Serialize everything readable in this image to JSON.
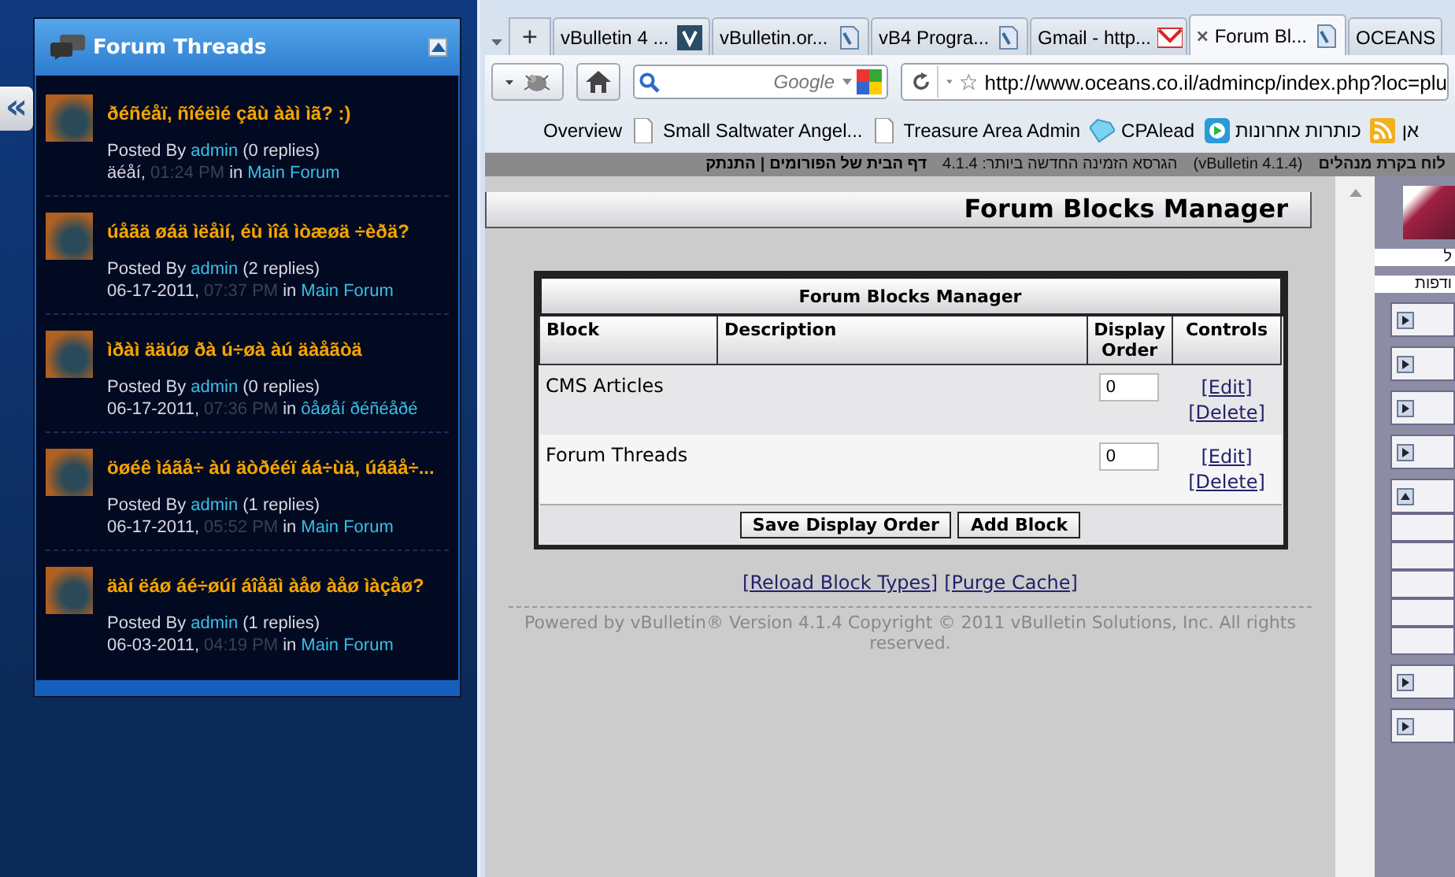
{
  "side_panel": {
    "collapse_tab": "«",
    "title": "Forum Threads",
    "threads": [
      {
        "title": "ðéñéåï, ñîéëìé çãù ààì ìã? :)",
        "posted_by": "Posted By",
        "user": "admin",
        "replies": "(0 replies)",
        "date": "äéåí,",
        "time": "01:24 PM",
        "in": "in",
        "forum": "Main Forum"
      },
      {
        "title": "úåãä øáä ìëåìí, éù ìîá ìòæøä ÷èðä?",
        "posted_by": "Posted By",
        "user": "admin",
        "replies": "(2 replies)",
        "date": "06-17-2011,",
        "time": "07:37 PM",
        "in": "in",
        "forum": "Main Forum"
      },
      {
        "title": "ìðàì ääúø ðà ú÷øà àú äàåãòä",
        "posted_by": "Posted By",
        "user": "admin",
        "replies": "(0 replies)",
        "date": "06-17-2011,",
        "time": "07:36 PM",
        "in": "in",
        "forum": "ôåøåí ðéñéåðé"
      },
      {
        "title": "öøéê ìáãå÷ àú äòðééï áá÷ùä, úáãå÷...",
        "posted_by": "Posted By",
        "user": "admin",
        "replies": "(1 replies)",
        "date": "06-17-2011,",
        "time": "05:52 PM",
        "in": "in",
        "forum": "Main Forum"
      },
      {
        "title": "äàí ëáø áé÷øúí áîåãì àåø àåø ìàçåø?",
        "posted_by": "Posted By",
        "user": "admin",
        "replies": "(1 replies)",
        "date": "06-03-2011,",
        "time": "04:19 PM",
        "in": "in",
        "forum": "Main Forum"
      }
    ]
  },
  "browser": {
    "new_tab": "+",
    "tabs": [
      {
        "label": "vBulletin 4 ...",
        "kind": "vb",
        "selected": false
      },
      {
        "label": "vBulletin.or...",
        "kind": "doc",
        "selected": false
      },
      {
        "label": "vB4 Progra...",
        "kind": "doc",
        "selected": false
      },
      {
        "label": "Gmail - http...",
        "kind": "mail",
        "selected": false
      },
      {
        "label": "Forum Bl...",
        "kind": "doc",
        "selected": true
      },
      {
        "label": "OCEANS",
        "kind": "plain",
        "selected": false
      }
    ],
    "search": {
      "placeholder": "Google"
    },
    "address": {
      "value": "http://www.oceans.co.il/admincp/index.php?loc=plu"
    },
    "bookmarks": [
      {
        "label": "Overview",
        "kind": "plain"
      },
      {
        "label": "Small Saltwater Angel...",
        "kind": "page"
      },
      {
        "label": "Treasure Area Admin",
        "kind": "page"
      },
      {
        "label": "CPAlead",
        "kind": "diamond"
      },
      {
        "label": "כותרות אחרונות",
        "kind": "play"
      },
      {
        "label": "אן",
        "kind": "rss"
      }
    ]
  },
  "admin_bar": {
    "title": "לוח בקרת מנהלים",
    "version": "(vBulletin 4.1.4)",
    "latest": "הגרסא הזמינה החדשה ביותר: 4.1.4",
    "links": [
      "דף הבית של הפורומים",
      "התנתק"
    ],
    "separator": "|"
  },
  "page": {
    "heading": "Forum Blocks Manager",
    "table": {
      "title": "Forum Blocks Manager",
      "columns": [
        "Block",
        "Description",
        "Display Order",
        "Controls"
      ],
      "rows": [
        {
          "block": "CMS Articles",
          "display_order": "0",
          "edit": "[Edit]",
          "delete": "[Delete]"
        },
        {
          "block": "Forum Threads",
          "display_order": "0",
          "edit": "[Edit]",
          "delete": "[Delete]"
        }
      ],
      "buttons": [
        "Save Display Order",
        "Add Block"
      ]
    },
    "links": [
      "[Reload Block Types]",
      "[Purge Cache]"
    ],
    "footer": "Powered by vBulletin® Version 4.1.4 Copyright © 2011 vBulletin Solutions, Inc. All rights reserved."
  },
  "right_sidebar": {
    "texts": [
      "ל",
      "ודפות"
    ],
    "groups": [
      {
        "expanded": false
      },
      {
        "expanded": false
      },
      {
        "expanded": false
      },
      {
        "expanded": false
      },
      {
        "expanded": true
      },
      {
        "expanded": false
      },
      {
        "expanded": false
      }
    ]
  }
}
